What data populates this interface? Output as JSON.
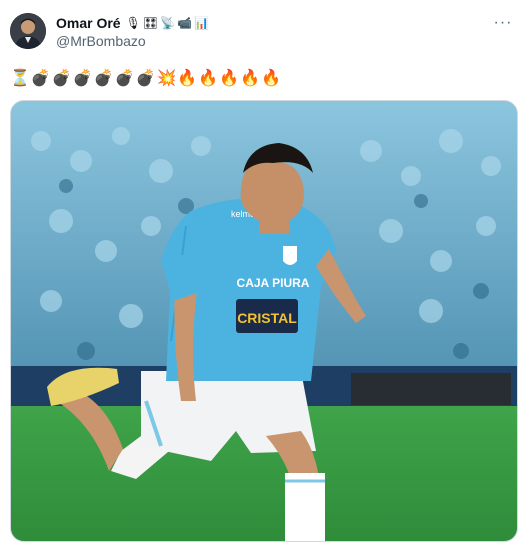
{
  "author": {
    "display_name": "Omar Oré",
    "handle": "@MrBombazo",
    "badges": [
      "🎙",
      "🎛",
      "📡",
      "📹",
      "📊"
    ],
    "avatar_icon": "profile-photo"
  },
  "tweet": {
    "text_emojis": {
      "hourglass": "⏳",
      "bombs": [
        "💣",
        "💣",
        "💣",
        "💣",
        "💣",
        "💣"
      ],
      "collision": "💥",
      "fires": [
        "🔥",
        "🔥",
        "🔥",
        "🔥",
        "🔥"
      ]
    },
    "more_label": "···",
    "media": {
      "jersey_sponsor": "CRISTAL",
      "jersey_sponsor_top": "CAJA PIURA",
      "brand": "kelme",
      "colors": {
        "sky": "#5fb6dc",
        "pitch": "#4caf50",
        "crowd": "#6aa5c2"
      }
    }
  }
}
